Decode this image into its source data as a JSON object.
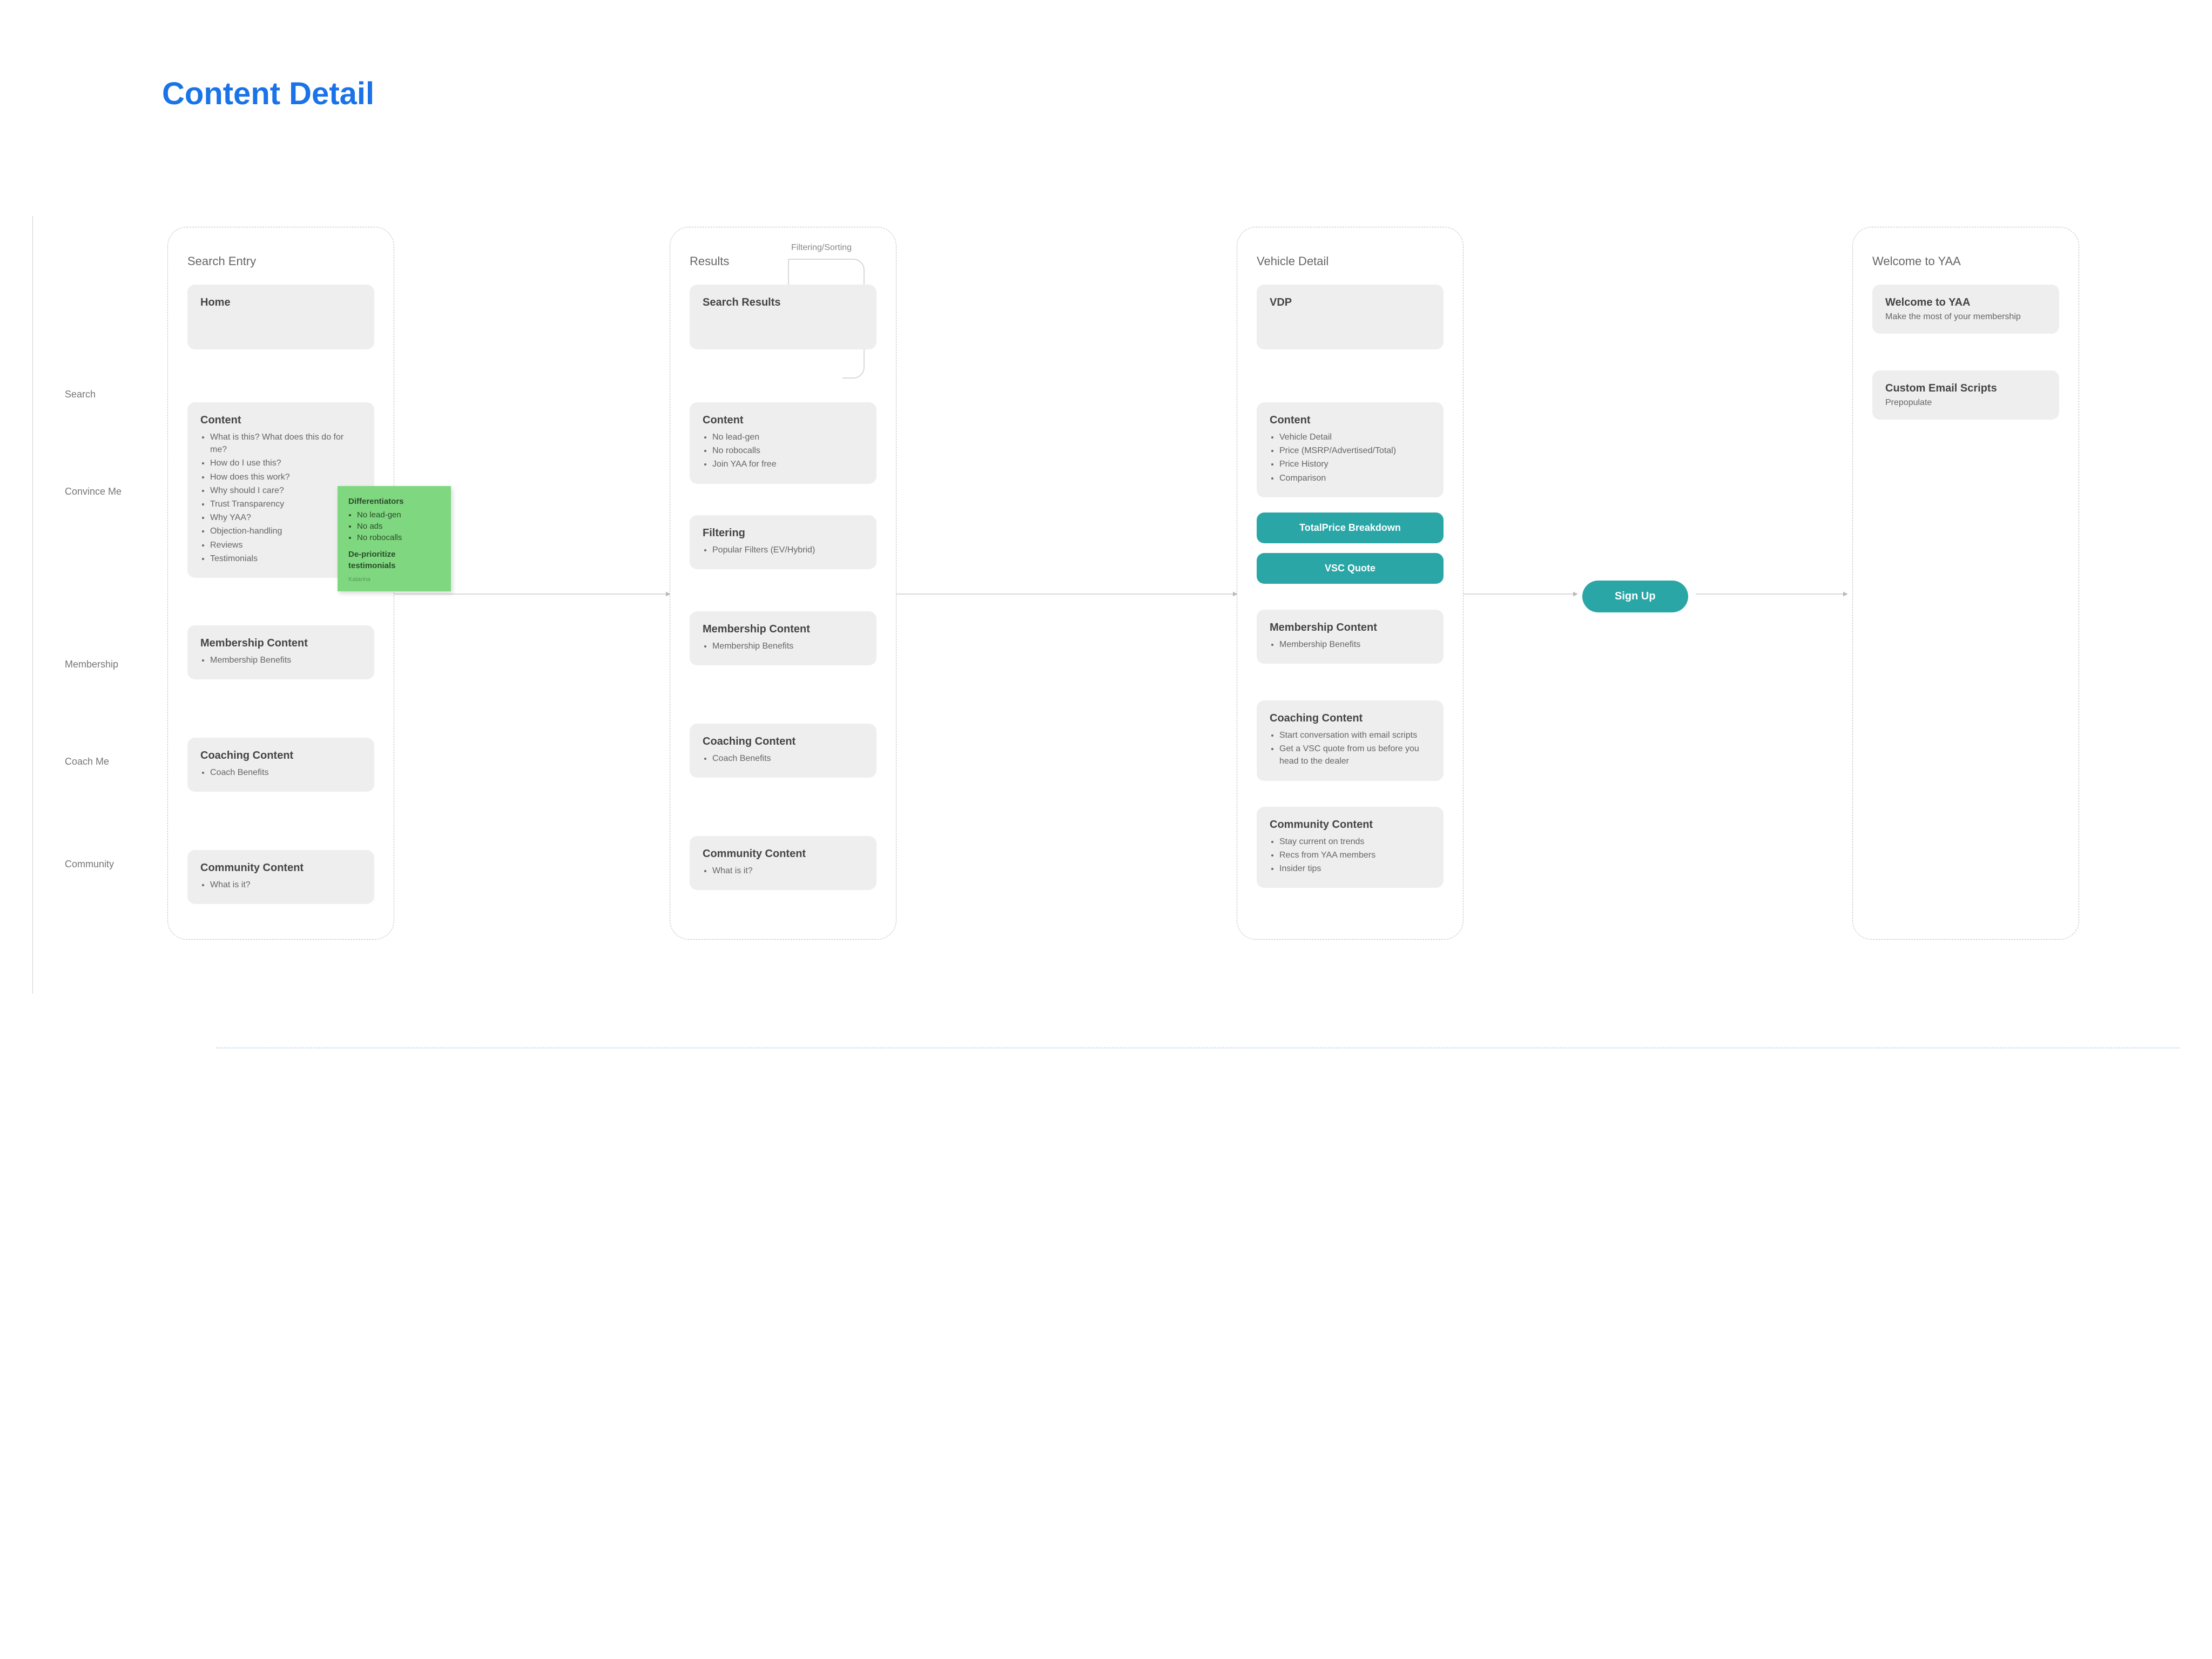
{
  "title": "Content Detail",
  "lanes": {
    "search": "Search",
    "convince": "Convince Me",
    "membership": "Membership",
    "coach": "Coach Me",
    "community": "Community"
  },
  "flow_label": "Filtering/Sorting",
  "signup": "Sign Up",
  "columns": {
    "searchEntry": {
      "title": "Search Entry",
      "home": "Home",
      "content": {
        "title": "Content",
        "items": [
          "What is this? What does this do for me?",
          "How do I use this?",
          "How does this work?",
          "Why should I care?",
          "Trust Transparency",
          "Why YAA?",
          "Objection-handling",
          "Reviews",
          "Testimonials"
        ]
      },
      "membership": {
        "title": "Membership Content",
        "items": [
          "Membership Benefits"
        ]
      },
      "coaching": {
        "title": "Coaching Content",
        "items": [
          "Coach Benefits"
        ]
      },
      "community": {
        "title": "Community Content",
        "items": [
          "What is it?"
        ]
      }
    },
    "results": {
      "title": "Results",
      "searchResults": "Search Results",
      "content": {
        "title": "Content",
        "items": [
          "No lead-gen",
          "No robocalls",
          "Join YAA for free"
        ]
      },
      "filtering": {
        "title": "Filtering",
        "items": [
          "Popular Filters (EV/Hybrid)"
        ]
      },
      "membership": {
        "title": "Membership Content",
        "items": [
          "Membership Benefits"
        ]
      },
      "coaching": {
        "title": "Coaching Content",
        "items": [
          "Coach Benefits"
        ]
      },
      "community": {
        "title": "Community Content",
        "items": [
          "What is it?"
        ]
      }
    },
    "vehicleDetail": {
      "title": "Vehicle Detail",
      "vdp": "VDP",
      "content": {
        "title": "Content",
        "items": [
          "Vehicle Detail",
          "Price (MSRP/Advertised/Total)",
          "Price History",
          "Comparison"
        ]
      },
      "pill1": "TotalPrice Breakdown",
      "pill2": "VSC Quote",
      "membership": {
        "title": "Membership Content",
        "items": [
          "Membership Benefits"
        ]
      },
      "coaching": {
        "title": "Coaching Content",
        "items": [
          "Start conversation with email scripts",
          "Get a VSC quote from us before you head to the dealer"
        ]
      },
      "community": {
        "title": "Community Content",
        "items": [
          "Stay current on trends",
          "Recs from YAA members",
          "Insider tips"
        ]
      }
    },
    "welcome": {
      "title": "Welcome to YAA",
      "welcomeCard": {
        "title": "Welcome to YAA",
        "sub": "Make the most of your membership"
      },
      "scripts": {
        "title": "Custom Email Scripts",
        "sub": "Prepopulate"
      }
    }
  },
  "sticky": {
    "heading": "Differentiators",
    "items": [
      "No lead-gen",
      "No ads",
      "No robocalls"
    ],
    "note": "De-prioritize testimonials",
    "sig": "Katarina"
  }
}
